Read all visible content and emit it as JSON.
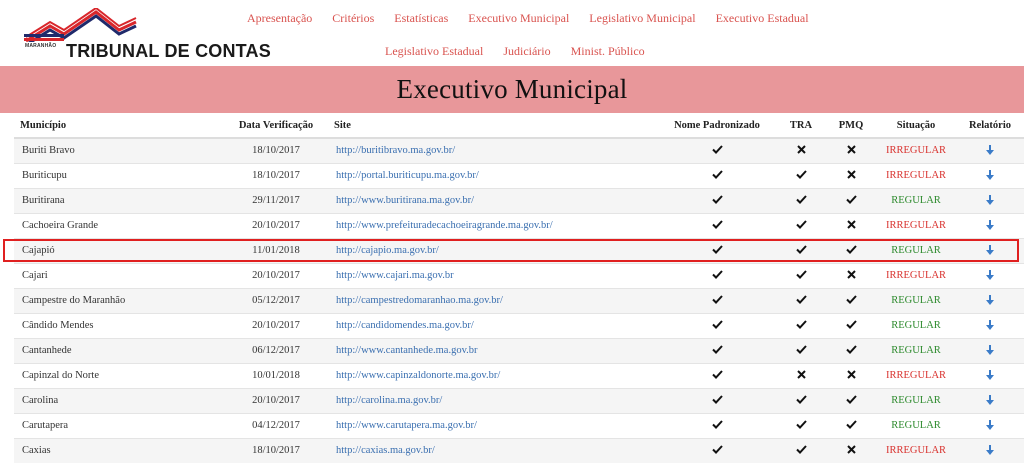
{
  "logo": {
    "state": "MARANHÃO",
    "name": "TRIBUNAL DE CONTAS"
  },
  "nav": {
    "row1": [
      "Apresentação",
      "Critérios",
      "Estatísticas",
      "Executivo Municipal",
      "Legislativo Municipal",
      "Executivo Estadual"
    ],
    "row2": [
      "Legislativo Estadual",
      "Judiciário",
      "Minist. Público"
    ]
  },
  "page_title": "Executivo Municipal",
  "table": {
    "headers": [
      "Município",
      "Data Verificação",
      "Site",
      "Nome Padronizado",
      "TRA",
      "PMQ",
      "Situação",
      "Relatório"
    ],
    "rows": [
      {
        "municipio": "Buriti Bravo",
        "data": "18/10/2017",
        "site": "http://buritibravo.ma.gov.br/",
        "nome": "check",
        "tra": "cross",
        "pmq": "cross",
        "situacao": "IRREGULAR"
      },
      {
        "municipio": "Buriticupu",
        "data": "18/10/2017",
        "site": "http://portal.buriticupu.ma.gov.br/",
        "nome": "check",
        "tra": "check",
        "pmq": "cross",
        "situacao": "IRREGULAR"
      },
      {
        "municipio": "Buritirana",
        "data": "29/11/2017",
        "site": "http://www.buritirana.ma.gov.br/",
        "nome": "check",
        "tra": "check",
        "pmq": "check",
        "situacao": "REGULAR"
      },
      {
        "municipio": "Cachoeira Grande",
        "data": "20/10/2017",
        "site": "http://www.prefeituradecachoeiragrande.ma.gov.br/",
        "nome": "check",
        "tra": "check",
        "pmq": "cross",
        "situacao": "IRREGULAR"
      },
      {
        "municipio": "Cajapió",
        "data": "11/01/2018",
        "site": "http://cajapio.ma.gov.br/",
        "nome": "check",
        "tra": "check",
        "pmq": "check",
        "situacao": "REGULAR"
      },
      {
        "municipio": "Cajari",
        "data": "20/10/2017",
        "site": "http://www.cajari.ma.gov.br",
        "nome": "check",
        "tra": "check",
        "pmq": "cross",
        "situacao": "IRREGULAR"
      },
      {
        "municipio": "Campestre do Maranhão",
        "data": "05/12/2017",
        "site": "http://campestredomaranhao.ma.gov.br/",
        "nome": "check",
        "tra": "check",
        "pmq": "check",
        "situacao": "REGULAR"
      },
      {
        "municipio": "Cândido Mendes",
        "data": "20/10/2017",
        "site": "http://candidomendes.ma.gov.br/",
        "nome": "check",
        "tra": "check",
        "pmq": "check",
        "situacao": "REGULAR"
      },
      {
        "municipio": "Cantanhede",
        "data": "06/12/2017",
        "site": "http://www.cantanhede.ma.gov.br",
        "nome": "check",
        "tra": "check",
        "pmq": "check",
        "situacao": "REGULAR"
      },
      {
        "municipio": "Capinzal do Norte",
        "data": "10/01/2018",
        "site": "http://www.capinzaldonorte.ma.gov.br/",
        "nome": "check",
        "tra": "cross",
        "pmq": "cross",
        "situacao": "IRREGULAR"
      },
      {
        "municipio": "Carolina",
        "data": "20/10/2017",
        "site": "http://carolina.ma.gov.br/",
        "nome": "check",
        "tra": "check",
        "pmq": "check",
        "situacao": "REGULAR"
      },
      {
        "municipio": "Carutapera",
        "data": "04/12/2017",
        "site": "http://www.carutapera.ma.gov.br/",
        "nome": "check",
        "tra": "check",
        "pmq": "check",
        "situacao": "REGULAR"
      },
      {
        "municipio": "Caxias",
        "data": "18/10/2017",
        "site": "http://caxias.ma.gov.br/",
        "nome": "check",
        "tra": "check",
        "pmq": "cross",
        "situacao": "IRREGULAR"
      }
    ]
  },
  "icons": {
    "check": "check-icon",
    "cross": "cross-icon",
    "report": "download-arrow-icon"
  },
  "colors": {
    "banner": "#e8979a",
    "nav_link": "#d9534f",
    "irregular": "#d9322e",
    "regular": "#2c8a2c",
    "site_link": "#3a6fb0",
    "report_arrow": "#3a7bc8"
  }
}
